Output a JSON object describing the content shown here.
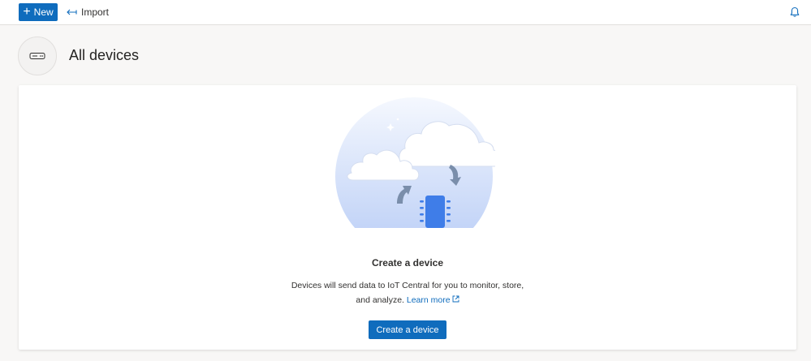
{
  "toolbar": {
    "new_label": "New",
    "import_label": "Import"
  },
  "header": {
    "title": "All devices",
    "icon": "device-icon"
  },
  "empty_state": {
    "title": "Create a device",
    "description_line1": "Devices will send data to IoT Central for you to monitor, store,",
    "description_line2": "and analyze. ",
    "learn_more": "Learn more",
    "create_button": "Create a device"
  },
  "colors": {
    "accent": "#0f6cbd",
    "page_background": "#f8f7f6",
    "card_background": "#ffffff"
  }
}
